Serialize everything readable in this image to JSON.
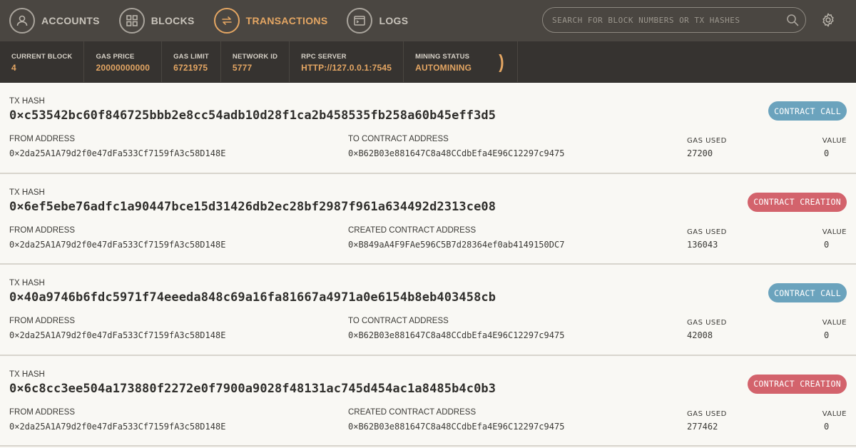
{
  "nav": {
    "accounts": "ACCOUNTS",
    "blocks": "BLOCKS",
    "transactions": "TRANSACTIONS",
    "logs": "LOGS"
  },
  "search": {
    "placeholder": "SEARCH FOR BLOCK NUMBERS OR TX HASHES"
  },
  "status": [
    {
      "label": "CURRENT BLOCK",
      "value": "4"
    },
    {
      "label": "GAS PRICE",
      "value": "20000000000"
    },
    {
      "label": "GAS LIMIT",
      "value": "6721975"
    },
    {
      "label": "NETWORK ID",
      "value": "5777"
    },
    {
      "label": "RPC SERVER",
      "value": "HTTP://127.0.0.1:7545"
    },
    {
      "label": "MINING STATUS",
      "value": "AUTOMINING"
    }
  ],
  "labels": {
    "tx_hash": "TX HASH",
    "from": "FROM ADDRESS",
    "to_contract": "TO CONTRACT ADDRESS",
    "created_contract": "CREATED CONTRACT ADDRESS",
    "gas_used": "GAS USED",
    "value": "VALUE"
  },
  "transactions": [
    {
      "hash": "0×c53542bc60f846725bbb2e8cc54adb10d28f1ca2b458535fb258a60b45eff3d5",
      "type": "CONTRACT CALL",
      "from": "0×2da25A1A79d2f0e47dFa533Cf7159fA3c58D148E",
      "target_label": "TO CONTRACT ADDRESS",
      "target": "0×B62B03e881647C8a48CCdbEfa4E96C12297c9475",
      "gas_used": "27200",
      "value": "0"
    },
    {
      "hash": "0×6ef5ebe76adfc1a90447bce15d31426db2ec28bf2987f961a634492d2313ce08",
      "type": "CONTRACT CREATION",
      "from": "0×2da25A1A79d2f0e47dFa533Cf7159fA3c58D148E",
      "target_label": "CREATED CONTRACT ADDRESS",
      "target": "0×B849aA4F9FAe596C5B7d28364ef0ab4149150DC7",
      "gas_used": "136043",
      "value": "0"
    },
    {
      "hash": "0×40a9746b6fdc5971f74eeeda848c69a16fa81667a4971a0e6154b8eb403458cb",
      "type": "CONTRACT CALL",
      "from": "0×2da25A1A79d2f0e47dFa533Cf7159fA3c58D148E",
      "target_label": "TO CONTRACT ADDRESS",
      "target": "0×B62B03e881647C8a48CCdbEfa4E96C12297c9475",
      "gas_used": "42008",
      "value": "0"
    },
    {
      "hash": "0×6c8cc3ee504a173880f2272e0f7900a9028f48131ac745d454ac1a8485b4c0b3",
      "type": "CONTRACT CREATION",
      "from": "0×2da25A1A79d2f0e47dFa533Cf7159fA3c58D148E",
      "target_label": "CREATED CONTRACT ADDRESS",
      "target": "0×B62B03e881647C8a48CCdbEfa4E96C12297c9475",
      "gas_used": "277462",
      "value": "0"
    }
  ],
  "colors": {
    "accent": "#e4a663",
    "call_badge": "#6ba3bd",
    "create_badge": "#d3636c"
  },
  "icons": {
    "accounts": "user-icon",
    "blocks": "grid-icon",
    "transactions": "swap-arrows-icon",
    "logs": "terminal-icon",
    "search": "search-icon",
    "settings": "gear-icon"
  }
}
